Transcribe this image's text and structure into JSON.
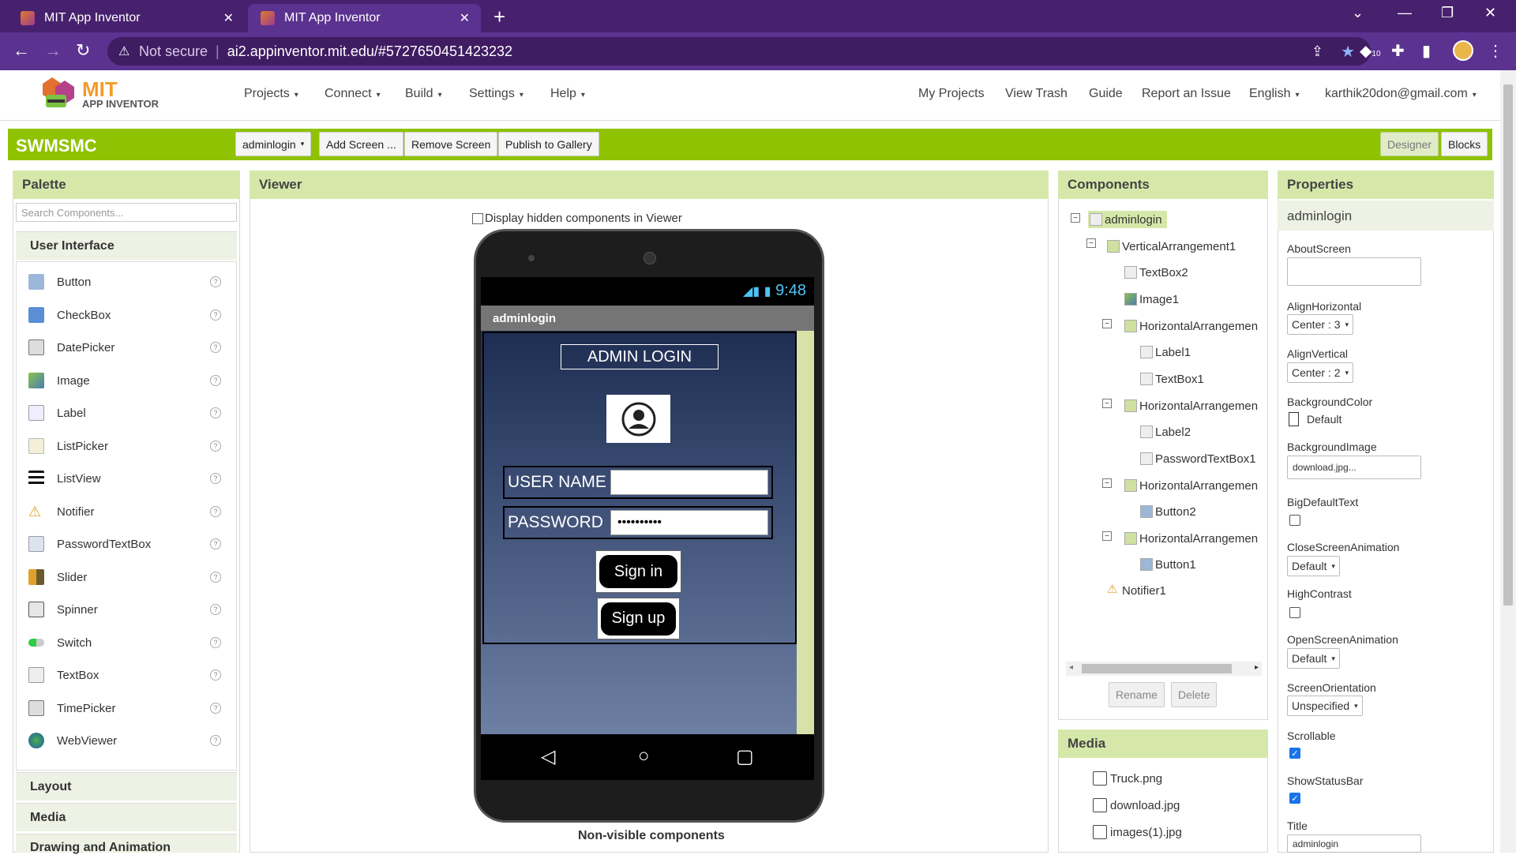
{
  "browser": {
    "tabs": [
      {
        "title": "MIT App Inventor"
      },
      {
        "title": "MIT App Inventor"
      }
    ],
    "security_label": "Not secure",
    "url": "ai2.appinventor.mit.edu/#5727650451423232",
    "extension_badge": "10"
  },
  "header": {
    "logo_line1": "MIT",
    "logo_line2": "APP INVENTOR",
    "menus": [
      "Projects",
      "Connect",
      "Build",
      "Settings",
      "Help"
    ],
    "right_links": [
      "My Projects",
      "View Trash",
      "Guide",
      "Report an Issue",
      "English",
      "karthik20don@gmail.com"
    ]
  },
  "project_bar": {
    "name": "SWMSMC",
    "screen_select": "adminlogin",
    "add_screen": "Add Screen ...",
    "remove_screen": "Remove Screen",
    "publish": "Publish to Gallery",
    "designer": "Designer",
    "blocks": "Blocks"
  },
  "palette": {
    "title": "Palette",
    "search_placeholder": "Search Components...",
    "ui_section": "User Interface",
    "items": [
      "Button",
      "CheckBox",
      "DatePicker",
      "Image",
      "Label",
      "ListPicker",
      "ListView",
      "Notifier",
      "PasswordTextBox",
      "Slider",
      "Spinner",
      "Switch",
      "TextBox",
      "TimePicker",
      "WebViewer"
    ],
    "help_glyph": "?",
    "sections": [
      "Layout",
      "Media",
      "Drawing and Animation"
    ]
  },
  "viewer": {
    "title": "Viewer",
    "hidden_toggle": "Display hidden components in Viewer",
    "status_time": "9:48",
    "screen_title": "adminlogin",
    "admin_label": "ADMIN LOGIN",
    "username_label": "USER NAME",
    "password_label": "PASSWORD",
    "password_value": "••••••••••",
    "signin": "Sign in",
    "signup": "Sign up",
    "non_visible": "Non-visible components"
  },
  "components": {
    "title": "Components",
    "tree": [
      "adminlogin",
      "VerticalArrangement1",
      "TextBox2",
      "Image1",
      "HorizontalArrangemen",
      "Label1",
      "TextBox1",
      "HorizontalArrangemen",
      "Label2",
      "PasswordTextBox1",
      "HorizontalArrangemen",
      "Button2",
      "HorizontalArrangemen",
      "Button1",
      "Notifier1"
    ],
    "rename": "Rename",
    "delete": "Delete"
  },
  "media": {
    "title": "Media",
    "files": [
      "Truck.png",
      "download.jpg",
      "images(1).jpg"
    ]
  },
  "properties": {
    "title": "Properties",
    "component": "adminlogin",
    "about_screen": "AboutScreen",
    "align_h_label": "AlignHorizontal",
    "align_h_value": "Center : 3",
    "align_v_label": "AlignVertical",
    "align_v_value": "Center : 2",
    "bg_color_label": "BackgroundColor",
    "bg_color_value": "Default",
    "bg_image_label": "BackgroundImage",
    "bg_image_value": "download.jpg...",
    "big_text_label": "BigDefaultText",
    "close_anim_label": "CloseScreenAnimation",
    "close_anim_value": "Default",
    "high_contrast_label": "HighContrast",
    "open_anim_label": "OpenScreenAnimation",
    "open_anim_value": "Default",
    "orientation_label": "ScreenOrientation",
    "orientation_value": "Unspecified",
    "scrollable_label": "Scrollable",
    "status_bar_label": "ShowStatusBar",
    "title_label": "Title",
    "title_value": "adminlogin"
  },
  "colors": {
    "browser_frame": "#47216e",
    "project_bar": "#8fc202",
    "panel_header": "#d6e8a9",
    "accent_blue": "#1a73e8"
  }
}
